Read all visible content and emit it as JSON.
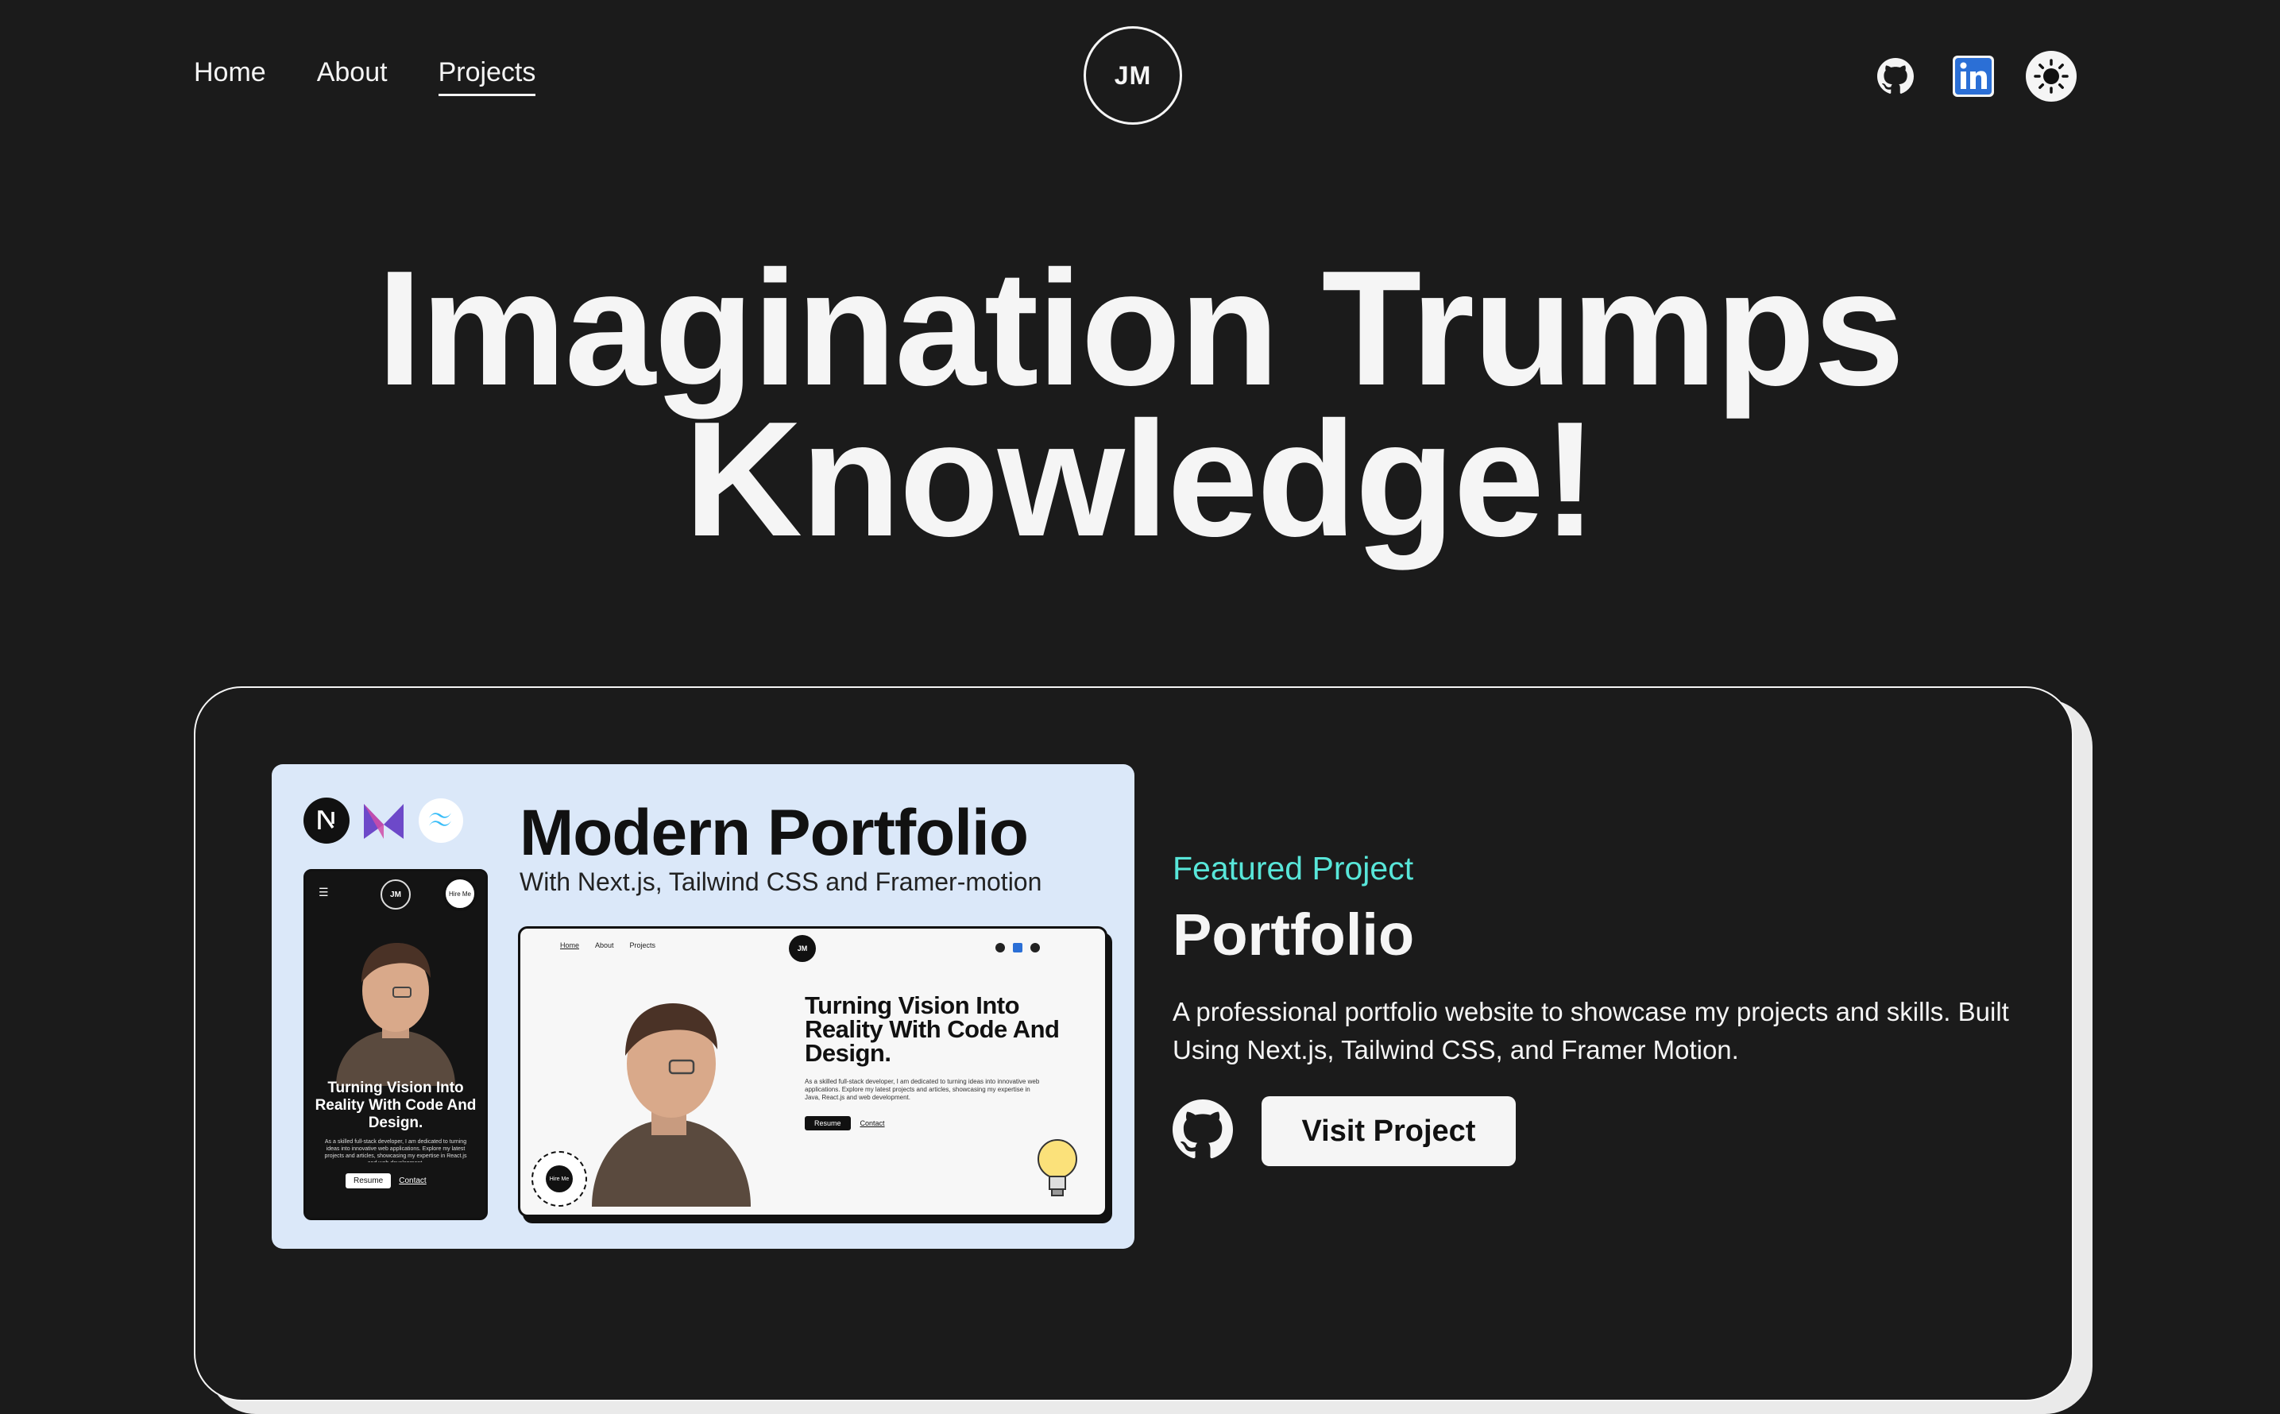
{
  "nav": {
    "links": [
      {
        "label": "Home",
        "active": false
      },
      {
        "label": "About",
        "active": false
      },
      {
        "label": "Projects",
        "active": true
      }
    ],
    "logo": "JM",
    "socials": [
      "github-icon",
      "linkedin-icon",
      "theme-toggle-sun-icon"
    ]
  },
  "hero": {
    "line1": "Imagination Trumps",
    "line2": "Knowledge!"
  },
  "featured": {
    "screenshot": {
      "tech_icons": [
        "nextjs-icon",
        "framer-motion-icon",
        "tailwind-icon"
      ],
      "title": "Modern Portfolio",
      "subtitle": "With Next.js, Tailwind CSS and Framer-motion",
      "phone": {
        "logo": "JM",
        "hire": "Hire Me",
        "heading": "Turning Vision Into Reality With Code And Design.",
        "text": "As a skilled full-stack developer, I am dedicated to turning ideas into innovative web applications. Explore my latest projects and articles, showcasing my expertise in React.js and web development.",
        "resume": "Resume",
        "contact": "Contact"
      },
      "laptop": {
        "nav": [
          "Home",
          "About",
          "Projects"
        ],
        "logo": "JM",
        "heading": "Turning Vision Into Reality With Code And Design.",
        "text": "As a skilled full-stack developer, I am dedicated to turning ideas into innovative web applications. Explore my latest projects and articles, showcasing my expertise in Java, React.js and web development.",
        "resume": "Resume",
        "contact": "Contact",
        "hire": "Hire Me"
      }
    },
    "label": "Featured Project",
    "title": "Portfolio",
    "description": "A professional portfolio website to showcase my projects and skills. Built Using Next.js, Tailwind CSS, and Framer Motion.",
    "visit_label": "Visit Project"
  },
  "colors": {
    "background": "#1b1b1b",
    "text": "#f5f5f5",
    "accent": "#58e6d9",
    "screenshot_bg": "#dbe8f9",
    "linkedin": "#2b6fd6"
  }
}
